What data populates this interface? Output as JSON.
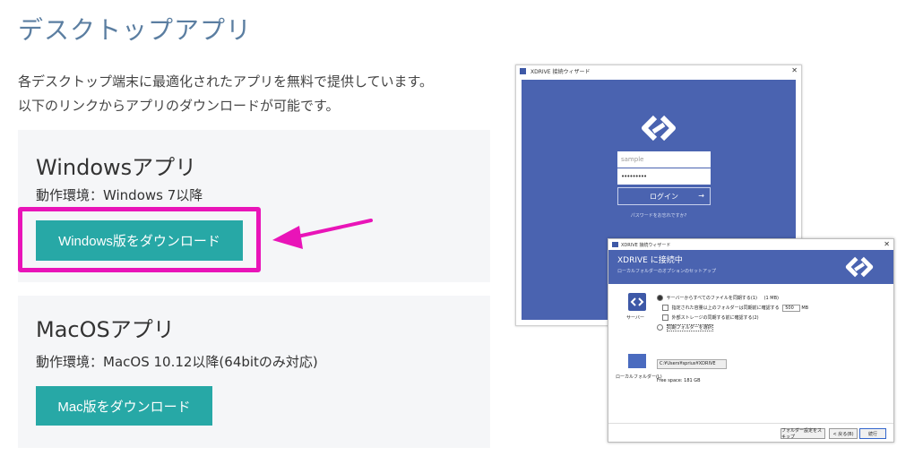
{
  "page": {
    "title": "デスクトップアプリ",
    "intro_line1": "各デスクトップ端末に最適化されたアプリを無料で提供しています。",
    "intro_line2": "以下のリンクからアプリのダウンロードが可能です。"
  },
  "windows": {
    "heading": "Windowsアプリ",
    "env": "動作環境：Windows 7以降",
    "button": "Windows版をダウンロード"
  },
  "mac": {
    "heading": "MacOSアプリ",
    "env": "動作環境：MacOS 10.12以降(64bitのみ対応)",
    "button": "Mac版をダウンロード"
  },
  "colors": {
    "accent": "#27a8a6",
    "highlight": "#e914b8",
    "title": "#5b7ea1",
    "app_blue": "#4a63b0"
  },
  "login_screenshot": {
    "window_title": "XDRIVE 接続ウィザード",
    "username_placeholder": "sample",
    "password_mask": "•••••••••",
    "login_button": "ログイン",
    "login_arrow": "→",
    "forgot": "パスワードをお忘れですか?"
  },
  "sync_screenshot": {
    "window_title": "XDRIVE 接続ウィザード",
    "heading": "XDRIVE に接続中",
    "subheading": "ローカルフォルダーのオプションのセットアップ",
    "server_label": "サーバー",
    "opt_sync_all": "サーバーからすべてのファイルを同期する(1)",
    "opt_sync_all_size": "(1 MB)",
    "opt_confirm_large": "指定された容量以上のフォルダーは同期前に確認する",
    "opt_confirm_value": "500",
    "opt_confirm_unit": "MB",
    "opt_external": "外部ストレージの同期する前に確認する(2)",
    "opt_select": "同期フォルダーを選択",
    "local_label": "ローカルフォルダー(L)",
    "local_path": "C:¥Users¥sprius¥XDRIVE",
    "free_space": "Free space: 181 GB",
    "btn_skip": "フォルダー設定をスキップ",
    "btn_back": "< 戻る(B)",
    "btn_next": "続行"
  }
}
